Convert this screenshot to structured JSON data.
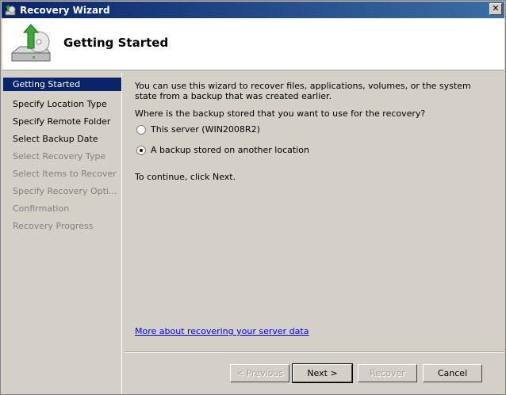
{
  "window": {
    "title": "Recovery Wizard",
    "close": "✕"
  },
  "header": {
    "title": "Getting Started"
  },
  "steps": [
    {
      "label": "Getting Started",
      "state": "selected"
    },
    {
      "label": "Specify Location Type",
      "state": "enabled"
    },
    {
      "label": "Specify Remote Folder",
      "state": "enabled"
    },
    {
      "label": "Select Backup Date",
      "state": "enabled"
    },
    {
      "label": "Select Recovery Type",
      "state": "disabled"
    },
    {
      "label": "Select Items to Recover",
      "state": "disabled"
    },
    {
      "label": "Specify Recovery Opti...",
      "state": "disabled"
    },
    {
      "label": "Confirmation",
      "state": "disabled"
    },
    {
      "label": "Recovery Progress",
      "state": "disabled"
    }
  ],
  "main": {
    "intro": "You can use this wizard to recover files, applications, volumes, or the system state from a backup that was created earlier.",
    "question": "Where is the backup stored that you want to use for the recovery?",
    "options": [
      {
        "label": "This server (WIN2008R2)",
        "checked": false
      },
      {
        "label": "A backup stored on another location",
        "checked": true
      }
    ],
    "continue": "To continue, click Next.",
    "link": "More about recovering your server data"
  },
  "buttons": {
    "previous": "< Previous",
    "next": "Next >",
    "recover": "Recover",
    "cancel": "Cancel"
  }
}
